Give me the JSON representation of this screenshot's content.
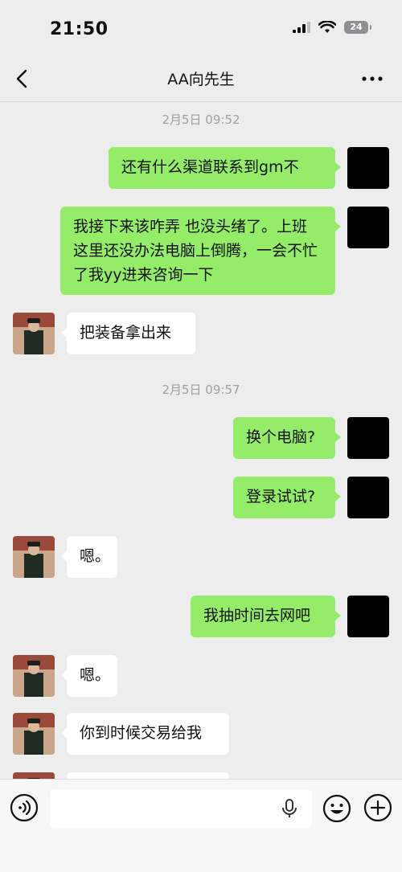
{
  "status_bar": {
    "time": "21:50",
    "battery_level": "24",
    "icons": [
      "signal-icon",
      "wifi-icon",
      "battery-icon"
    ]
  },
  "header": {
    "title": "AA向先生",
    "back_icon": "chevron-left-icon",
    "more_icon": "more-dots-icon"
  },
  "messages": [
    {
      "type": "timestamp",
      "text": "2月5日 09:52"
    },
    {
      "type": "out",
      "sender": "me",
      "text": "还有什么渠道联系到gm不"
    },
    {
      "type": "out",
      "sender": "me",
      "text": "我接下来该咋弄  也没头绪了。上班这里还没办法电脑上倒腾，一会不忙了我yy进来咨询一下"
    },
    {
      "type": "in",
      "sender": "contact",
      "text": "把装备拿出来"
    },
    {
      "type": "timestamp",
      "text": "2月5日 09:57"
    },
    {
      "type": "out",
      "sender": "me",
      "text": "换个电脑?"
    },
    {
      "type": "out",
      "sender": "me",
      "text": "登录试试?"
    },
    {
      "type": "in",
      "sender": "contact",
      "text": "嗯。"
    },
    {
      "type": "out",
      "sender": "me",
      "text": "我抽时间去网吧"
    },
    {
      "type": "in",
      "sender": "contact",
      "text": "嗯。"
    },
    {
      "type": "in",
      "sender": "contact",
      "text": "你到时候交易给我"
    }
  ],
  "input_bar": {
    "value": "",
    "icons": [
      "voice-icon",
      "microphone-icon",
      "emoji-icon",
      "plus-icon"
    ]
  },
  "colors": {
    "outgoing_bubble": "#95ec69",
    "incoming_bubble": "#ffffff",
    "background": "#ededed"
  }
}
